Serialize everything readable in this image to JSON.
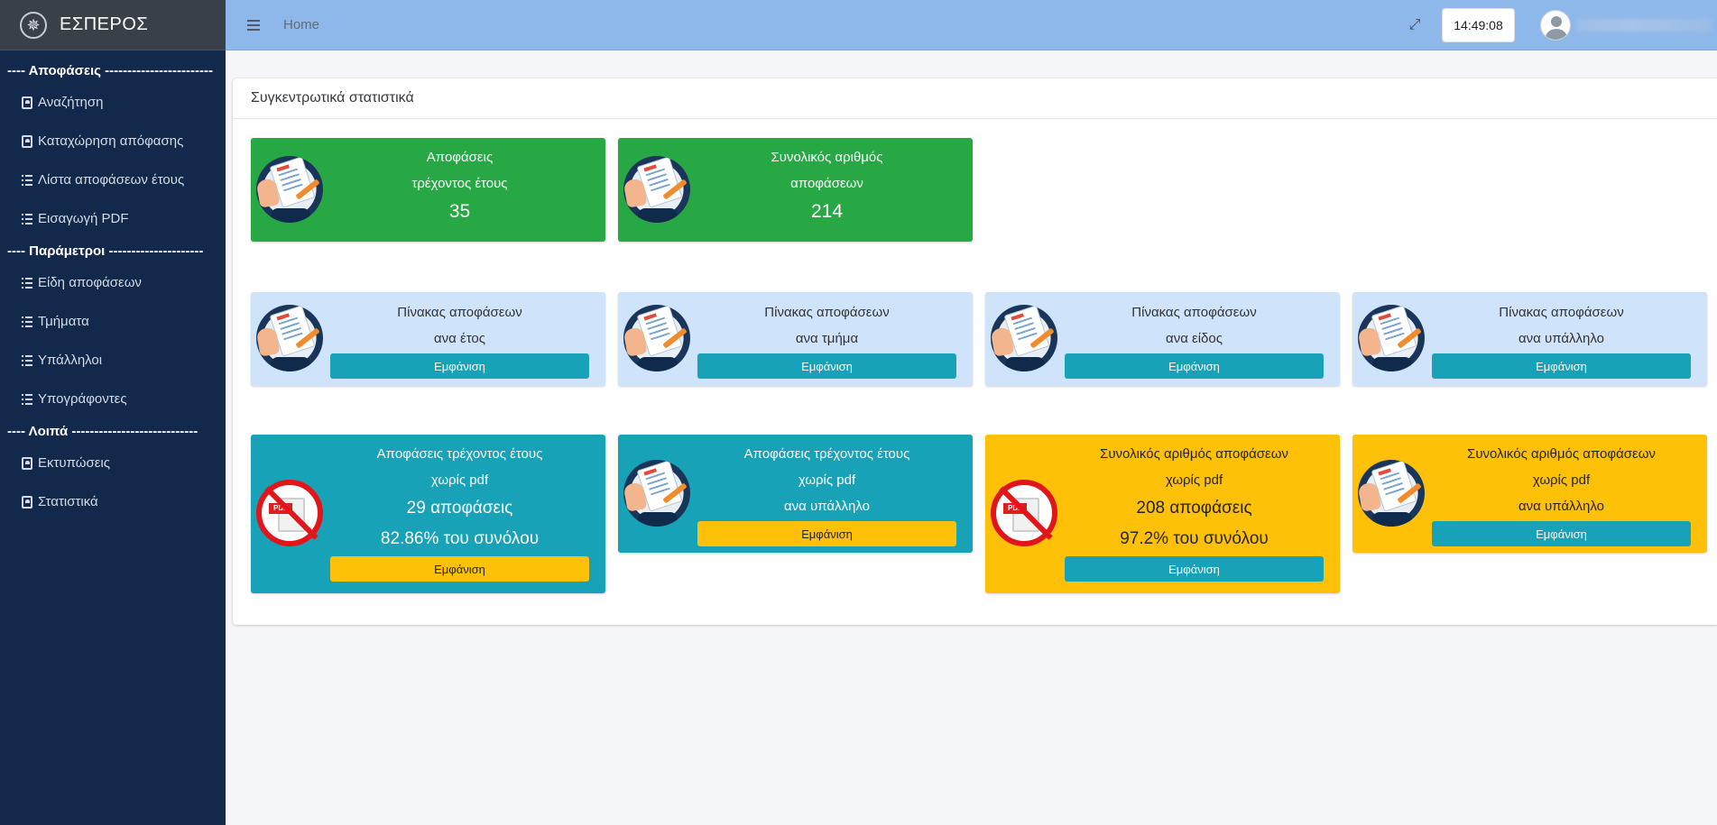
{
  "app": {
    "title": "ΕΣΠΕΡΟΣ",
    "logo_icon": "compass-icon"
  },
  "sidebar": {
    "sections": [
      {
        "header": "---- Αποφάσεις ------------------------",
        "items": [
          {
            "label": "Αναζήτηση",
            "icon": "id-card-icon"
          },
          {
            "label": "Καταχώρηση απόφασης",
            "icon": "id-card-icon"
          },
          {
            "label": "Λίστα αποφάσεων έτους",
            "icon": "list-icon"
          },
          {
            "label": "Εισαγωγή PDF",
            "icon": "list-icon"
          }
        ]
      },
      {
        "header": "---- Παράμετροι ---------------------",
        "items": [
          {
            "label": "Είδη αποφάσεων",
            "icon": "list-icon"
          },
          {
            "label": "Τμήματα",
            "icon": "list-icon"
          },
          {
            "label": "Υπάλληλοι",
            "icon": "list-icon"
          },
          {
            "label": "Υπογράφοντες",
            "icon": "list-icon"
          }
        ]
      },
      {
        "header": "---- Λοιπά ----------------------------",
        "items": [
          {
            "label": "Εκτυπώσεις",
            "icon": "id-card-icon"
          },
          {
            "label": "Στατιστικά",
            "icon": "id-card-icon"
          }
        ]
      }
    ]
  },
  "topbar": {
    "home": "Home",
    "clock": "14:49:08"
  },
  "main": {
    "title": "Συγκεντρωτικά στατιστικά",
    "row1": [
      {
        "line1": "Αποφάσεις",
        "line2": "τρέχοντος έτους",
        "value": "35"
      },
      {
        "line1": "Συνολικός αριθμός",
        "line2": "αποφάσεων",
        "value": "214"
      }
    ],
    "row2": [
      {
        "line1": "Πίνακας αποφάσεων",
        "line2": "ανα έτος",
        "button": "Εμφάνιση"
      },
      {
        "line1": "Πίνακας αποφάσεων",
        "line2": "ανα τμήμα",
        "button": "Εμφάνιση"
      },
      {
        "line1": "Πίνακας αποφάσεων",
        "line2": "ανα είδος",
        "button": "Εμφάνιση"
      },
      {
        "line1": "Πίνακας αποφάσεων",
        "line2": "ανα υπάλληλο",
        "button": "Εμφάνιση"
      }
    ],
    "row3": [
      {
        "line1": "Αποφάσεις τρέχοντος έτους",
        "line2": "χωρίς pdf",
        "line3": "29 αποφάσεις",
        "line4": "82.86% του συνόλου",
        "button": "Εμφάνιση",
        "icon_text": "PDF"
      },
      {
        "line1": "Αποφάσεις τρέχοντος έτους",
        "line2": "χωρίς pdf",
        "line3": "ανα υπάλληλο",
        "button": "Εμφάνιση"
      },
      {
        "line1": "Συνολικός αριθμός αποφάσεων",
        "line2": "χωρίς pdf",
        "line3": "208 αποφάσεις",
        "line4": "97.2% του συνόλου",
        "button": "Εμφάνιση",
        "icon_text": "PDF"
      },
      {
        "line1": "Συνολικός αριθμός αποφάσεων",
        "line2": "χωρίς pdf",
        "line3": "ανα υπάλληλο",
        "button": "Εμφάνιση"
      }
    ]
  },
  "colors": {
    "sidebar": "#13294b",
    "topbar": "#8fb8ea",
    "success": "#28a745",
    "info": "#17a2b8",
    "warning": "#ffc107",
    "light_box": "#cfe4fb"
  }
}
